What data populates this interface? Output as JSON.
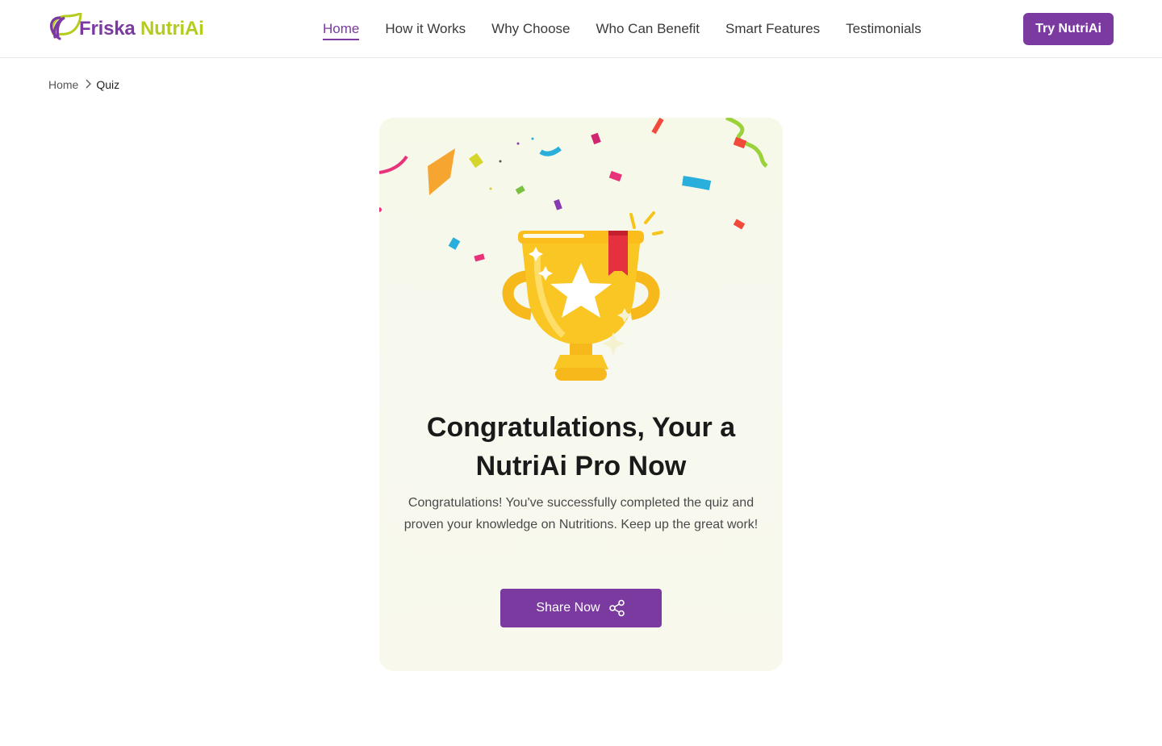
{
  "brand": {
    "name_part1": "Friska ",
    "name_part2": "NutriAi",
    "colors": {
      "purple": "#7b3aa0",
      "green": "#b5cc1e"
    }
  },
  "nav": {
    "items": [
      {
        "label": "Home",
        "active": true
      },
      {
        "label": "How it Works"
      },
      {
        "label": "Why Choose"
      },
      {
        "label": "Who Can Benefit"
      },
      {
        "label": "Smart Features"
      },
      {
        "label": "Testimonials"
      }
    ],
    "cta_label": "Try NutriAi"
  },
  "breadcrumb": {
    "home": "Home",
    "current": "Quiz",
    "separator_icon": "chevron-right-icon"
  },
  "result": {
    "title": "Congratulations, Your a NutriAi Pro Now",
    "description": "Congratulations! You've successfully completed the quiz and proven your knowledge on Nutritions. Keep up the great work!",
    "share_label": "Share Now",
    "share_icon": "share-icon",
    "illustration": "trophy-icon"
  }
}
